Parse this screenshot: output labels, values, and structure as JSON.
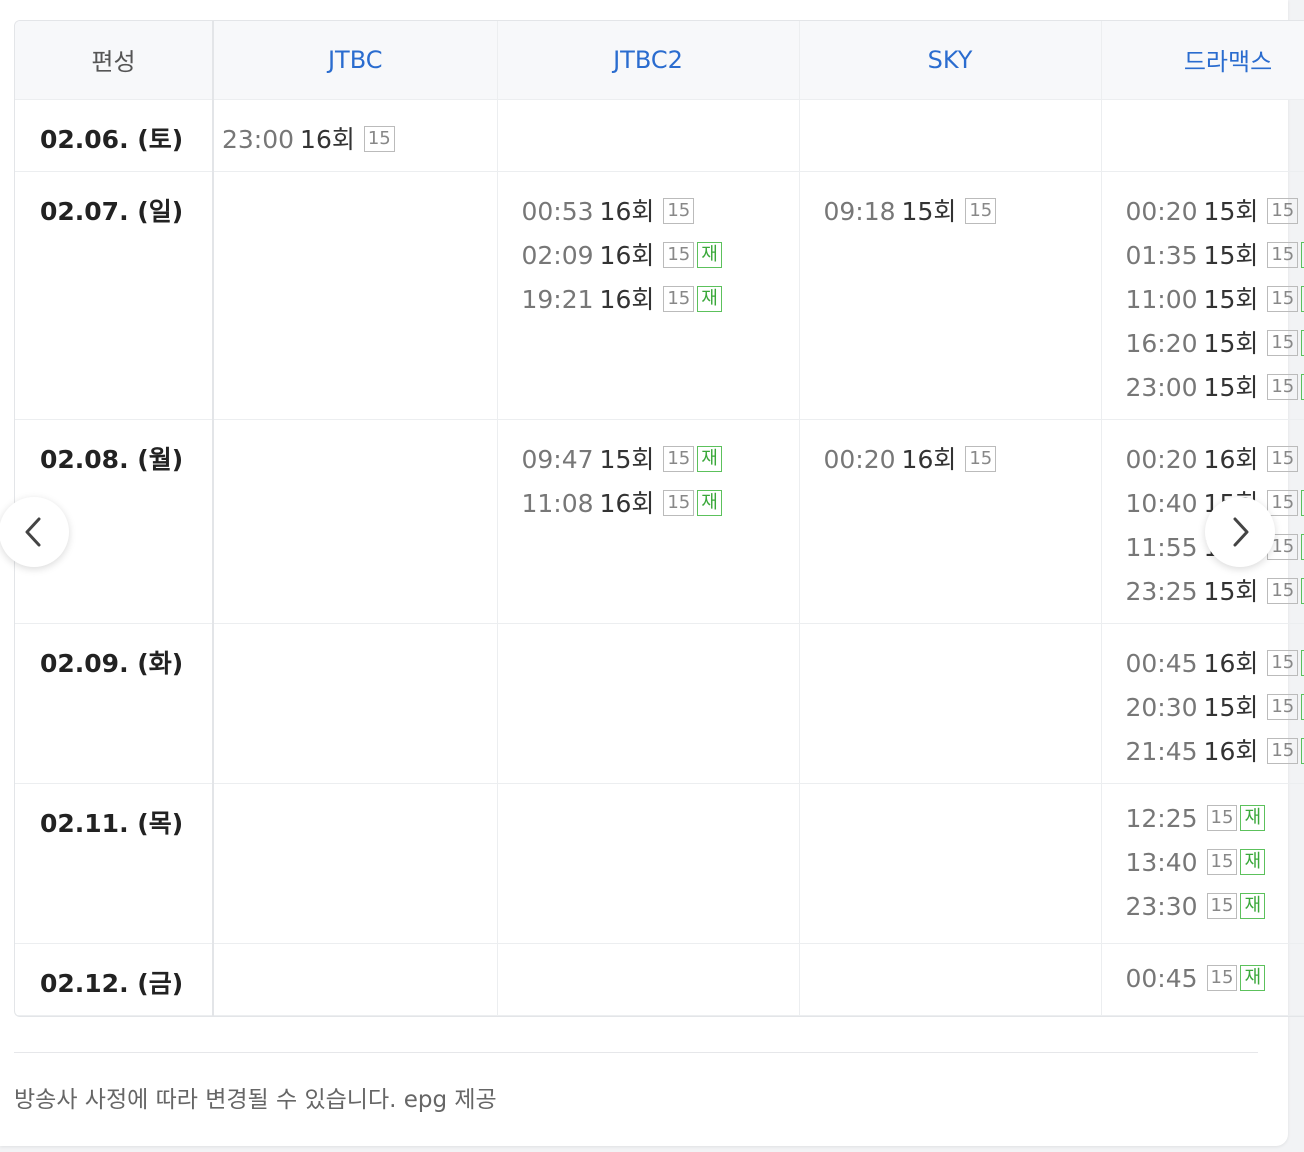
{
  "table": {
    "corner_label": "편성",
    "channels": [
      "JTBC",
      "JTBC2",
      "SKY",
      "드라맥스"
    ],
    "rows": [
      {
        "date": "02.06. (토)",
        "cells": [
          [
            {
              "time": "23:00",
              "ep": "16회",
              "rating": "15",
              "re": ""
            }
          ],
          [],
          [],
          []
        ]
      },
      {
        "date": "02.07. (일)",
        "cells": [
          [],
          [
            {
              "time": "00:53",
              "ep": "16회",
              "rating": "15",
              "re": ""
            },
            {
              "time": "02:09",
              "ep": "16회",
              "rating": "15",
              "re": "재"
            },
            {
              "time": "19:21",
              "ep": "16회",
              "rating": "15",
              "re": "재"
            }
          ],
          [
            {
              "time": "09:18",
              "ep": "15회",
              "rating": "15",
              "re": ""
            }
          ],
          [
            {
              "time": "00:20",
              "ep": "15회",
              "rating": "15",
              "re": ""
            },
            {
              "time": "01:35",
              "ep": "15회",
              "rating": "15",
              "re": "재"
            },
            {
              "time": "11:00",
              "ep": "15회",
              "rating": "15",
              "re": "재"
            },
            {
              "time": "16:20",
              "ep": "15회",
              "rating": "15",
              "re": "재"
            },
            {
              "time": "23:00",
              "ep": "15회",
              "rating": "15",
              "re": "재"
            }
          ]
        ]
      },
      {
        "date": "02.08. (월)",
        "cells": [
          [],
          [
            {
              "time": "09:47",
              "ep": "15회",
              "rating": "15",
              "re": "재"
            },
            {
              "time": "11:08",
              "ep": "16회",
              "rating": "15",
              "re": "재"
            }
          ],
          [
            {
              "time": "00:20",
              "ep": "16회",
              "rating": "15",
              "re": ""
            }
          ],
          [
            {
              "time": "00:20",
              "ep": "16회",
              "rating": "15",
              "re": ""
            },
            {
              "time": "10:40",
              "ep": "15회",
              "rating": "15",
              "re": "재"
            },
            {
              "time": "11:55",
              "ep": "16회",
              "rating": "15",
              "re": "재"
            },
            {
              "time": "23:25",
              "ep": "15회",
              "rating": "15",
              "re": "재"
            }
          ]
        ]
      },
      {
        "date": "02.09. (화)",
        "cells": [
          [],
          [],
          [],
          [
            {
              "time": "00:45",
              "ep": "16회",
              "rating": "15",
              "re": "재"
            },
            {
              "time": "20:30",
              "ep": "15회",
              "rating": "15",
              "re": "재"
            },
            {
              "time": "21:45",
              "ep": "16회",
              "rating": "15",
              "re": "재"
            }
          ]
        ]
      },
      {
        "date": "02.11. (목)",
        "cells": [
          [],
          [],
          [],
          [
            {
              "time": "12:25",
              "ep": "",
              "rating": "15",
              "re": "재"
            },
            {
              "time": "13:40",
              "ep": "",
              "rating": "15",
              "re": "재"
            },
            {
              "time": "23:30",
              "ep": "",
              "rating": "15",
              "re": "재"
            }
          ]
        ]
      },
      {
        "date": "02.12. (금)",
        "cells": [
          [],
          [],
          [],
          [
            {
              "time": "00:45",
              "ep": "",
              "rating": "15",
              "re": "재"
            }
          ]
        ]
      }
    ]
  },
  "footer": {
    "note": "방송사 사정에 따라 변경될 수 있습니다. epg 제공"
  },
  "nav": {
    "prev_icon": "chevron-left-icon",
    "next_icon": "chevron-right-icon"
  },
  "colors": {
    "channel_link": "#2a6ccf",
    "rerun_badge": "#3aa83a",
    "rating_badge": "#888888"
  }
}
